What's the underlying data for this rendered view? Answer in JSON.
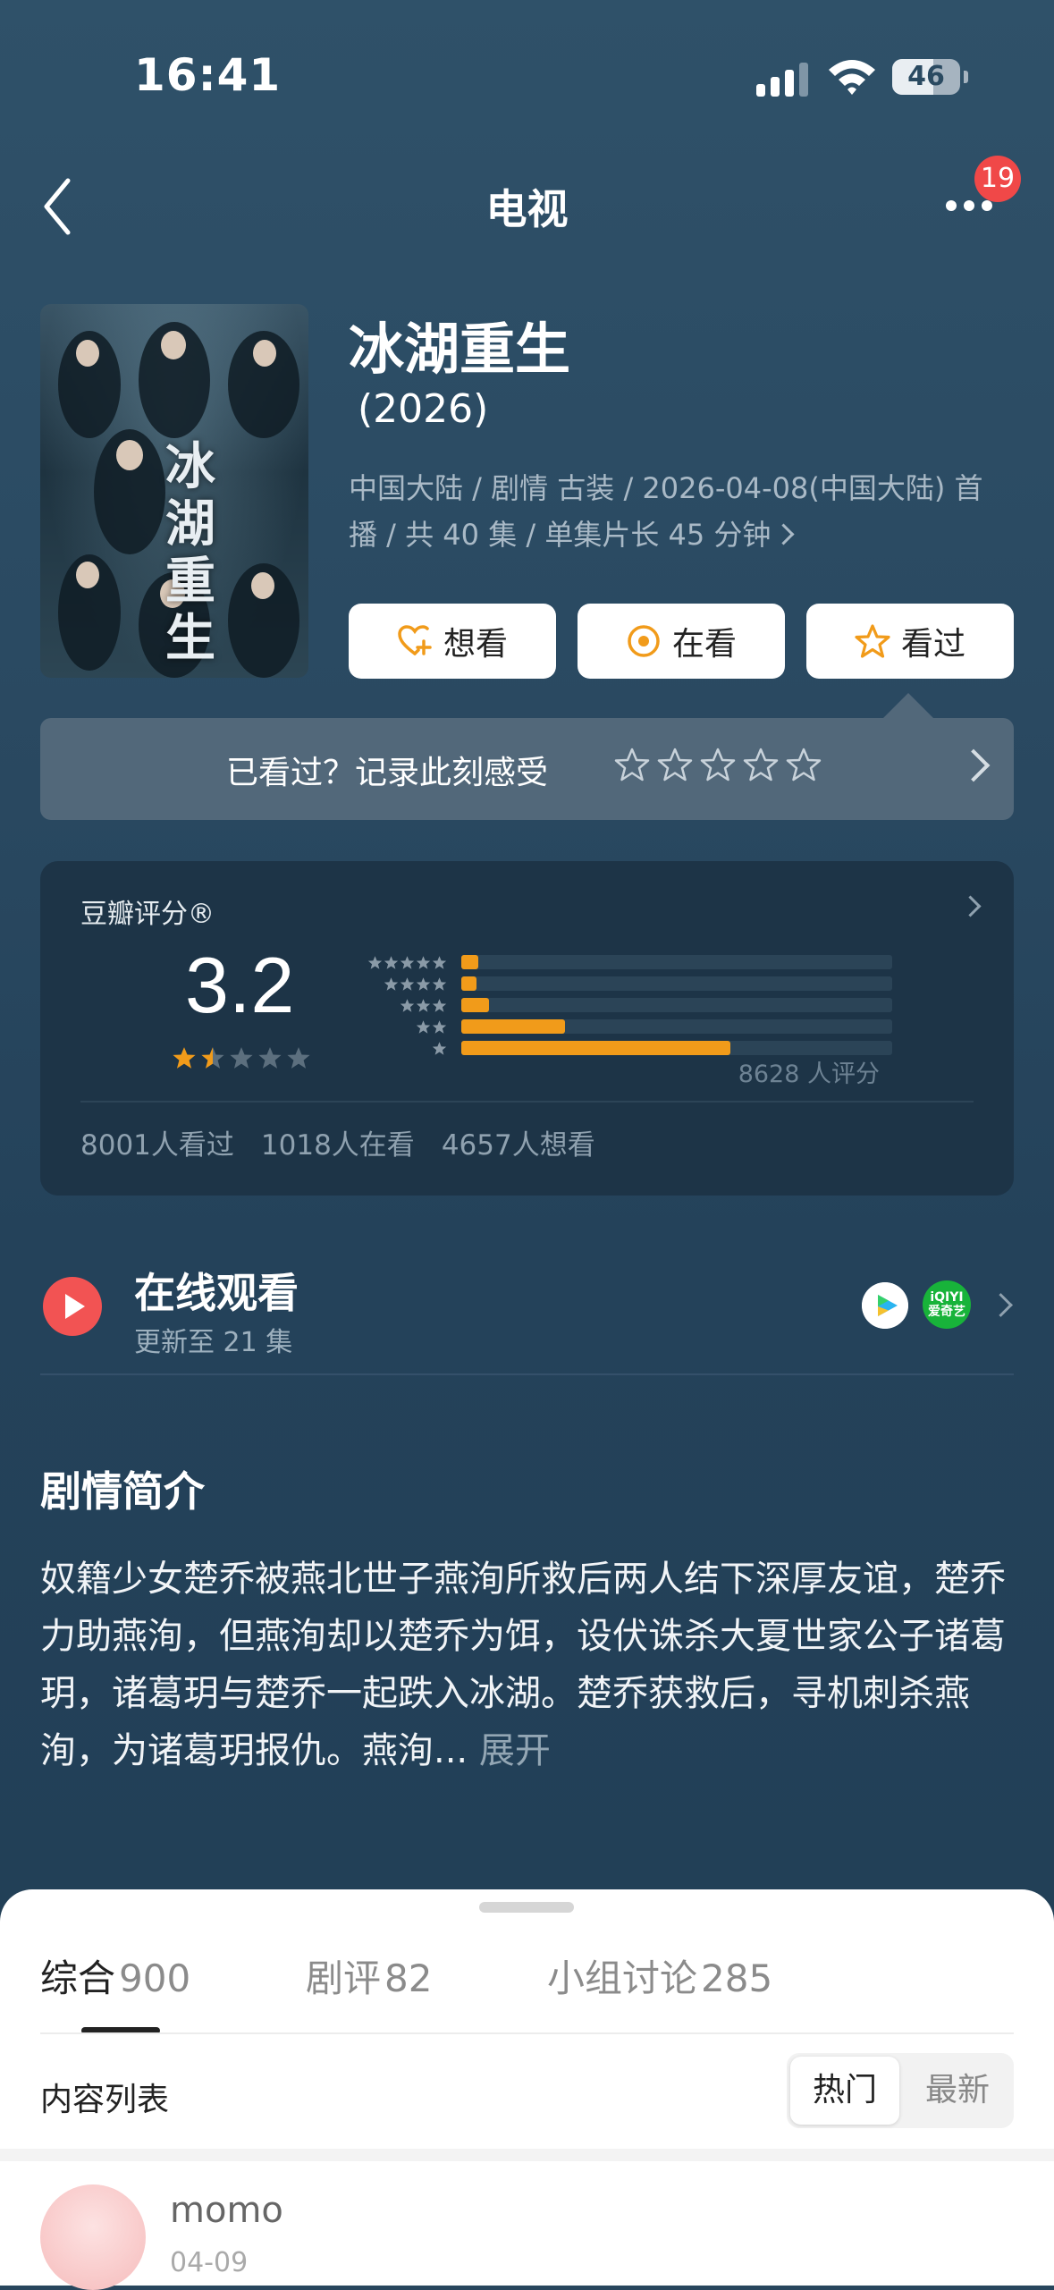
{
  "status": {
    "time": "16:41",
    "battery": "46"
  },
  "nav": {
    "title": "电视",
    "badge": "19"
  },
  "show": {
    "title": "冰湖重生",
    "year": "(2026)",
    "meta": "中国大陆 / 剧情 古装 / 2026-04-08(中国大陆) 首播 / 共 40 集 / 单集片长 45 分钟",
    "poster_title": "冰湖重生"
  },
  "actions": {
    "want": "想看",
    "watching": "在看",
    "watched": "看过"
  },
  "record": {
    "text": "已看过？记录此刻感受"
  },
  "rating": {
    "label": "豆瓣评分®",
    "score": "3.2",
    "score_value": 3.2,
    "star_fill": 1.5,
    "distribution": [
      {
        "stars": 5,
        "fraction": 0.04
      },
      {
        "stars": 4,
        "fraction": 0.035
      },
      {
        "stars": 3,
        "fraction": 0.065
      },
      {
        "stars": 2,
        "fraction": 0.24
      },
      {
        "stars": 1,
        "fraction": 0.625
      }
    ],
    "count": "8628 人评分",
    "watched": "8001人看过",
    "watching": "1018人在看",
    "want": "4657人想看",
    "accent": "#f19b1a"
  },
  "online": {
    "title": "在线观看",
    "sub": "更新至 21 集",
    "platform2": "iQIYI 爱奇艺"
  },
  "synopsis": {
    "title": "剧情简介",
    "text": "奴籍少女楚乔被燕北世子燕洵所救后两人结下深厚友谊，楚乔力助燕洵，但燕洵却以楚乔为饵，设伏诛杀大夏世家公子诸葛玥，诸葛玥与楚乔一起跌入冰湖。楚乔获救后，寻机刺杀燕洵，为诸葛玥报仇。燕洵...",
    "more": "展开"
  },
  "sheet": {
    "tabs": [
      {
        "label": "综合",
        "count": "900"
      },
      {
        "label": "剧评",
        "count": "82"
      },
      {
        "label": "小组讨论",
        "count": "285"
      }
    ],
    "list_label": "内容列表",
    "sort_hot": "热门",
    "sort_new": "最新",
    "post": {
      "user": "momo",
      "date": "04-09"
    }
  }
}
